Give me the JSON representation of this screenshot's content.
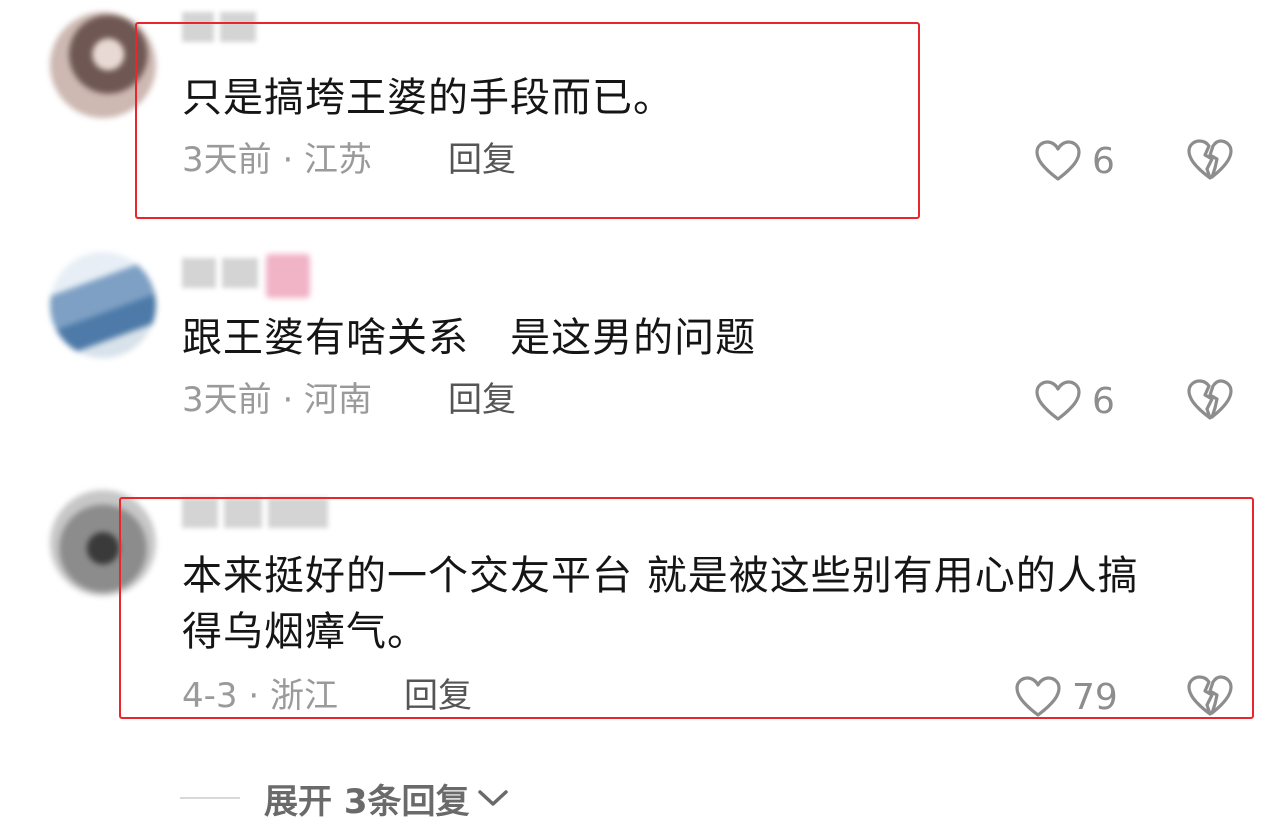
{
  "comments": [
    {
      "text": "只是搞垮王婆的手段而已。",
      "meta": "3天前 · 江苏",
      "reply": "回复",
      "likes": "6"
    },
    {
      "text": "跟王婆有啥关系   是这男的问题",
      "meta": "3天前 · 河南",
      "reply": "回复",
      "likes": "6"
    },
    {
      "text_line1": "本来挺好的一个交友平台 就是被这些别有用心的人搞",
      "text_line2": "得乌烟瘴气。",
      "meta": "4-3 · 浙江",
      "reply": "回复",
      "likes": "79"
    }
  ],
  "expand_replies": "展开 3条回复",
  "icons": {
    "like": "heart-outline-icon",
    "dislike": "broken-heart-icon",
    "expand": "chevron-down-icon"
  },
  "colors": {
    "highlight_box": "#e8262c",
    "meta_text": "#9a9a9a",
    "reply_text": "#555555"
  }
}
